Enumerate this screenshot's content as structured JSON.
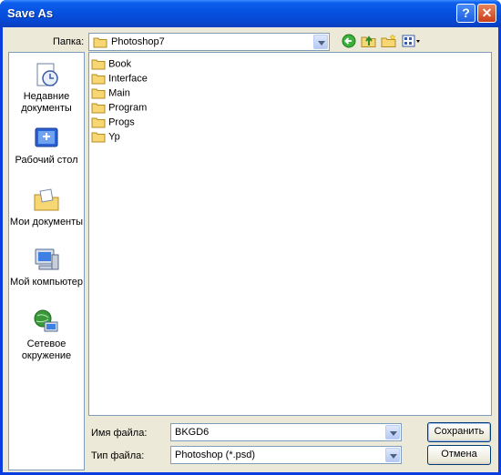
{
  "window": {
    "title": "Save As"
  },
  "titlebar": {
    "help": "?",
    "close": "✕"
  },
  "lookin": {
    "label": "Папка:",
    "value": "Photoshop7"
  },
  "places": [
    {
      "label": "Недавние документы"
    },
    {
      "label": "Рабочий стол"
    },
    {
      "label": "Мои документы"
    },
    {
      "label": "Мой компьютер"
    },
    {
      "label": "Сетевое окружение"
    }
  ],
  "files": [
    "Book",
    "Interface",
    "Main",
    "Program",
    "Progs",
    "Yp"
  ],
  "filename": {
    "label": "Имя файла:",
    "value": "BKGD6"
  },
  "filetype": {
    "label": "Тип файла:",
    "value": "Photoshop (*.psd)"
  },
  "buttons": {
    "save": "Сохранить",
    "cancel": "Отмена"
  },
  "icons": [
    "back-icon",
    "up-folder-icon",
    "new-folder-icon",
    "views-icon"
  ]
}
